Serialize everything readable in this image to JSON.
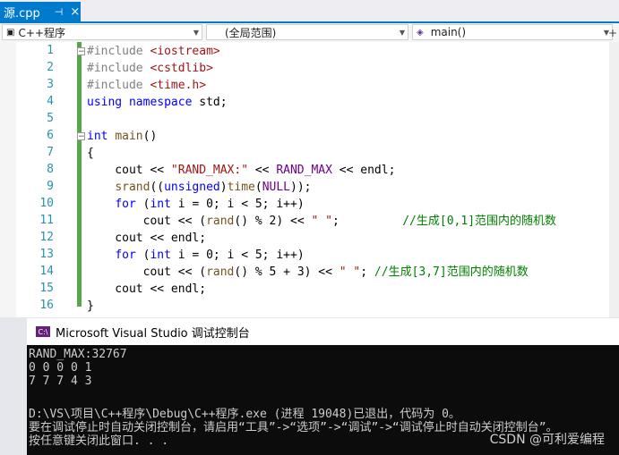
{
  "tab": {
    "label": "源.cpp",
    "pin": "⊣",
    "close": "×"
  },
  "nav": {
    "project": "C++程序",
    "scope": "(全局范围)",
    "member": "main()"
  },
  "line_numbers": [
    "1",
    "2",
    "3",
    "4",
    "5",
    "6",
    "7",
    "8",
    "9",
    "10",
    "11",
    "12",
    "13",
    "14",
    "15",
    "16"
  ],
  "console": {
    "title": "Microsoft Visual Studio 调试控制台",
    "lines": [
      "RAND_MAX:32767",
      "0 0 0 0 1",
      "7 7 7 4 3",
      "",
      "D:\\VS\\项目\\C++程序\\Debug\\C++程序.exe (进程 19048)已退出，代码为 0。",
      "要在调试停止时自动关闭控制台，请启用“工具”->“选项”->“调试”->“调试停止时自动关闭控制台”。",
      "按任意键关闭此窗口. . ."
    ]
  },
  "watermark": "CSDN @可利爱编程"
}
